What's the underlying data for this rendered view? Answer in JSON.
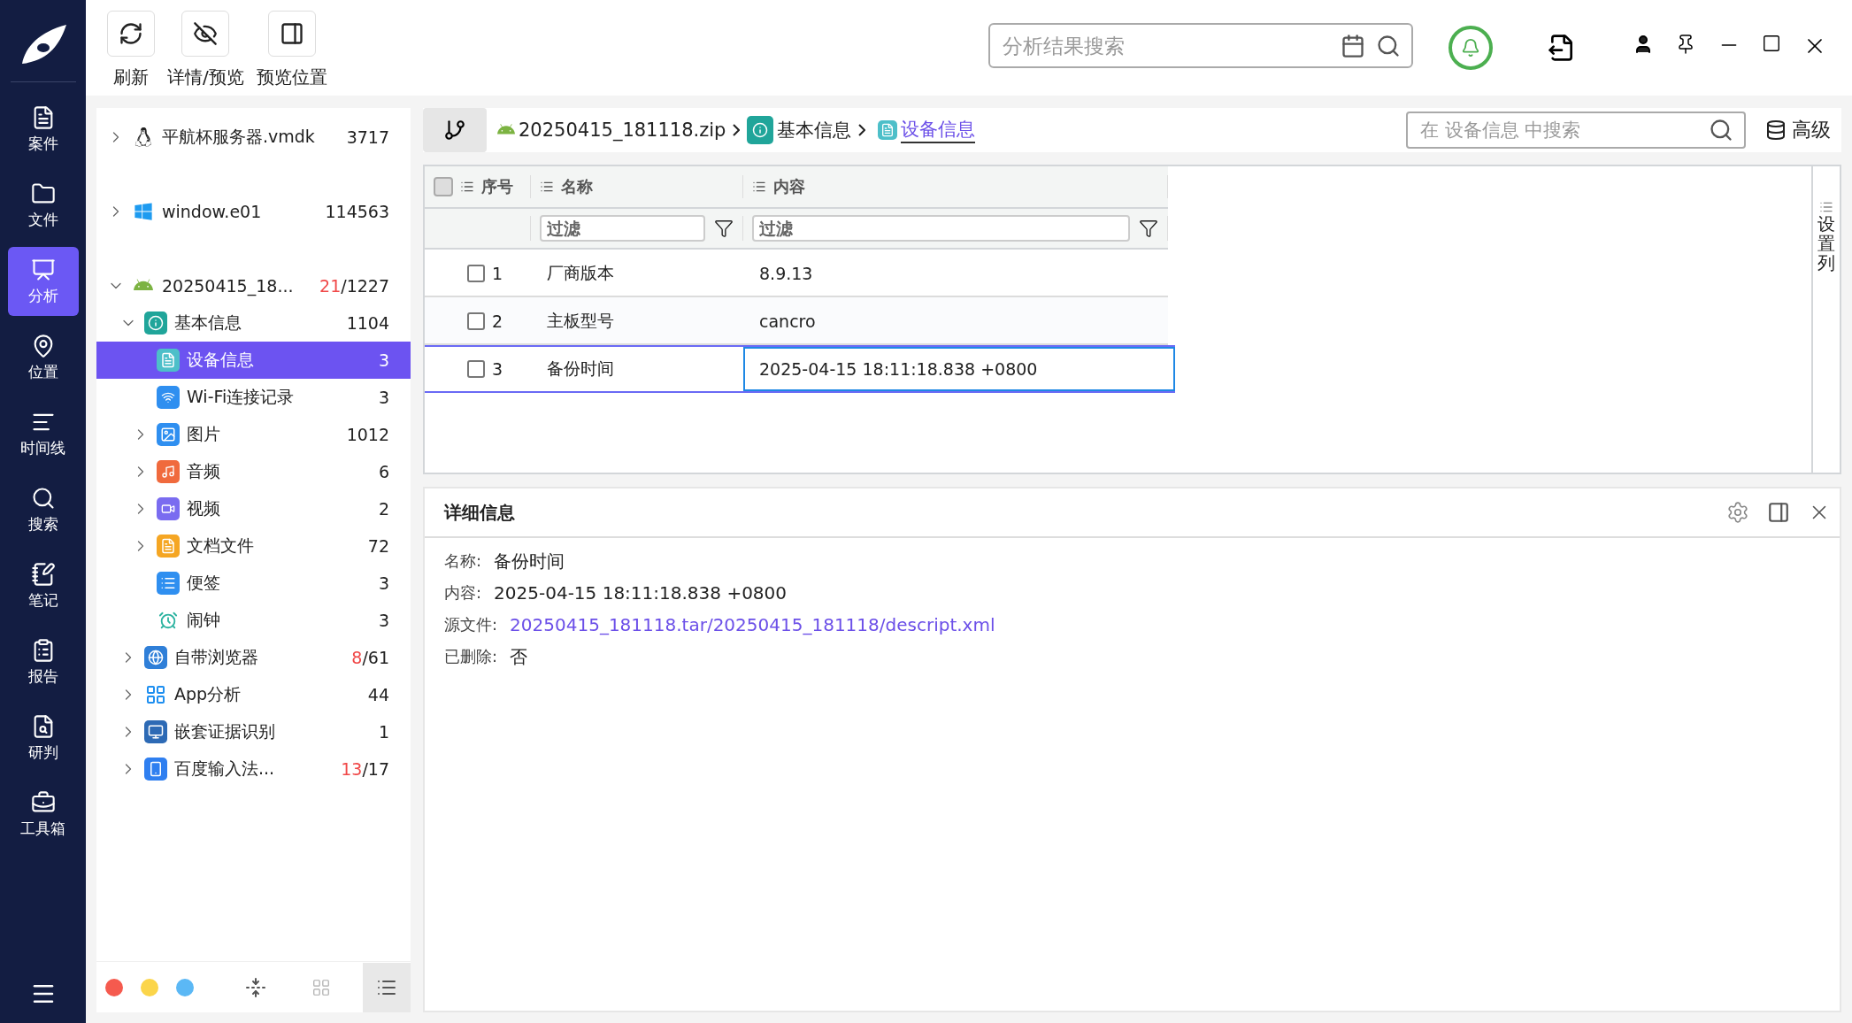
{
  "nav": [
    {
      "label": "案件",
      "selected": false
    },
    {
      "label": "文件",
      "selected": false
    },
    {
      "label": "分析",
      "selected": true
    },
    {
      "label": "位置",
      "selected": false
    },
    {
      "label": "时间线",
      "selected": false
    },
    {
      "label": "搜索",
      "selected": false
    },
    {
      "label": "笔记",
      "selected": false
    },
    {
      "label": "报告",
      "selected": false
    },
    {
      "label": "研判",
      "selected": false
    },
    {
      "label": "工具箱",
      "selected": false
    }
  ],
  "toolbar": {
    "buttons": [
      {
        "label": "刷新"
      },
      {
        "label": "详情/预览"
      },
      {
        "label": "预览位置"
      }
    ],
    "search": {
      "placeholder": "分析结果搜索"
    }
  },
  "tree": [
    {
      "label": "平航杯服务器.vmdk",
      "count": "3717",
      "expanded": false,
      "selected": false
    },
    {
      "label": "window.e01",
      "count": "114563",
      "expanded": false,
      "selected": false
    },
    {
      "label": "20250415_18...",
      "new_count": "21",
      "count": "/1227",
      "expanded": true,
      "selected": false,
      "children": [
        {
          "label": "基本信息",
          "count": "1104",
          "expanded": true,
          "selected": false,
          "children": [
            {
              "label": "设备信息",
              "count": "3",
              "selected": true
            },
            {
              "label": "Wi-Fi连接记录",
              "count": "3",
              "selected": false
            },
            {
              "label": "图片",
              "count": "1012",
              "expanded": false,
              "selected": false
            },
            {
              "label": "音频",
              "count": "6",
              "expanded": false,
              "selected": false
            },
            {
              "label": "视频",
              "count": "2",
              "expanded": false,
              "selected": false
            },
            {
              "label": "文档文件",
              "count": "72",
              "expanded": false,
              "selected": false
            },
            {
              "label": "便签",
              "count": "3",
              "selected": false
            },
            {
              "label": "闹钟",
              "count": "3",
              "selected": false
            }
          ]
        },
        {
          "label": "自带浏览器",
          "new_count": "8",
          "count": "/61",
          "expanded": false,
          "selected": false
        },
        {
          "label": "App分析",
          "count": "44",
          "expanded": false,
          "selected": false
        },
        {
          "label": "嵌套证据识别",
          "count": "1",
          "expanded": false,
          "selected": false
        },
        {
          "label": "百度输入法...",
          "new_count": "13",
          "count": "/17",
          "expanded": false,
          "selected": false
        }
      ]
    }
  ],
  "color_tags": [
    {
      "color": "#f55a4e"
    },
    {
      "color": "#fbd54a"
    },
    {
      "color": "#5bb8f5"
    }
  ],
  "breadcrumb": [
    {
      "label": "20250415_181118.zip",
      "selected": false
    },
    {
      "label": "基本信息",
      "selected": false
    },
    {
      "label": "设备信息",
      "selected": true
    }
  ],
  "table_search": {
    "placeholder": "在 设备信息 中搜索"
  },
  "advanced": "高级",
  "table": {
    "all_checked": false,
    "columns": [
      {
        "label": "序号"
      },
      {
        "label": "名称",
        "placeholder": "过滤"
      },
      {
        "label": "内容",
        "placeholder": "过滤"
      }
    ],
    "rows": [
      {
        "index": "1",
        "name": "厂商版本",
        "content": "8.9.13",
        "checked": false,
        "selected": false
      },
      {
        "index": "2",
        "name": "主板型号",
        "content": "cancro",
        "checked": false,
        "selected": false
      },
      {
        "index": "3",
        "name": "备份时间",
        "content": "2025-04-15 18:11:18.838 +0800",
        "checked": false,
        "selected": true
      }
    ],
    "column_settings": "设置列"
  },
  "detail": {
    "title": "详细信息",
    "fields": [
      {
        "label": "名称:",
        "value": "备份时间",
        "kind": "text"
      },
      {
        "label": "内容:",
        "value": "2025-04-15 18:11:18.838 +0800",
        "kind": "text"
      },
      {
        "label": "源文件:",
        "value": "20250415_181118.tar/20250415_181118/descript.xml",
        "kind": "link"
      },
      {
        "label": "已删除:",
        "value": "否",
        "kind": "text"
      }
    ]
  }
}
